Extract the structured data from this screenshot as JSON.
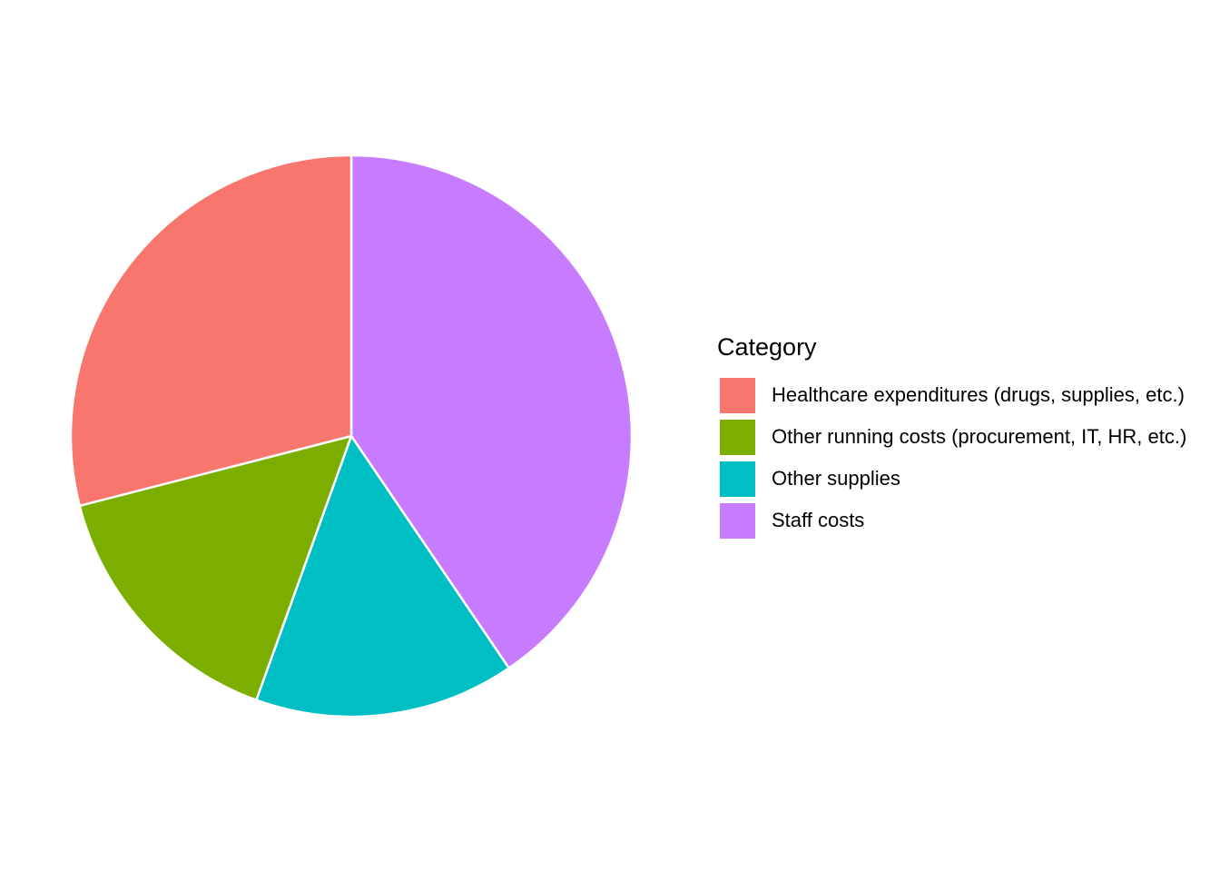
{
  "chart_data": {
    "type": "pie",
    "title": "",
    "legend": {
      "title": "Category",
      "position": "right"
    },
    "slices": [
      {
        "label": "Staff costs",
        "value": 40.5,
        "color": "#C77CFF"
      },
      {
        "label": "Other supplies",
        "value": 15.0,
        "color": "#00BFC4"
      },
      {
        "label": "Other running costs (procurement, IT, HR, etc.)",
        "value": 15.5,
        "color": "#7CAE00"
      },
      {
        "label": "Healthcare expenditures (drugs, supplies, etc.)",
        "value": 29.0,
        "color": "#F8766D"
      }
    ],
    "legend_items": [
      {
        "label": "Healthcare expenditures (drugs, supplies, etc.)",
        "color": "#F8766D"
      },
      {
        "label": "Other running costs (procurement, IT, HR, etc.)",
        "color": "#7CAE00"
      },
      {
        "label": "Other supplies",
        "color": "#00BFC4"
      },
      {
        "label": "Staff costs",
        "color": "#C77CFF"
      }
    ],
    "start": "12 o'clock",
    "direction": "clockwise",
    "slice_border_color": "#FFFFFF"
  }
}
